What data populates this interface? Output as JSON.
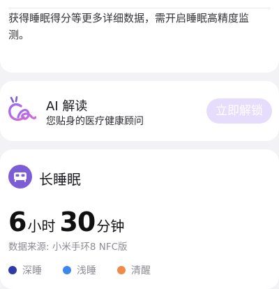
{
  "info": {
    "text": "获得睡眠得分等更多详细数据，需开启睡眠高精度监测。"
  },
  "ai": {
    "title": "AI 解读",
    "subtitle": "您贴身的医疗健康顾问",
    "unlock_label": "立即解锁",
    "logo_icon": "ai-sparkle-logo-icon",
    "colors": {
      "button_bg": "#e6dcfb",
      "logo_gradient_start": "#9a6cf0",
      "logo_gradient_end": "#d66bd8"
    }
  },
  "long_sleep": {
    "title": "长睡眠",
    "icon": "bed-icon",
    "hours": "6",
    "hours_unit": "小时",
    "minutes": "30",
    "minutes_unit": "分钟",
    "source": "数据来源: 小米手环8 NFC版",
    "legend": [
      {
        "label": "深睡",
        "color": "#2e3aa8"
      },
      {
        "label": "浅睡",
        "color": "#3d86f0"
      },
      {
        "label": "清醒",
        "color": "#f08a46"
      }
    ],
    "accent_color": "#7d5dd6"
  }
}
